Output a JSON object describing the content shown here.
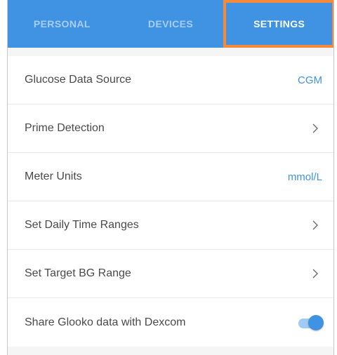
{
  "tabs": [
    {
      "label": "PERSONAL",
      "active": false
    },
    {
      "label": "DEVICES",
      "active": false
    },
    {
      "label": "SETTINGS",
      "active": true
    }
  ],
  "settings": {
    "glucose_source": {
      "label": "Glucose Data Source",
      "value": "CGM"
    },
    "prime_detection": {
      "label": "Prime Detection",
      "icon": "chevron-right-icon"
    },
    "meter_units": {
      "label": "Meter Units",
      "value": "mmol/L"
    },
    "daily_time_ranges": {
      "label": "Set Daily Time Ranges",
      "icon": "chevron-right-icon"
    },
    "target_bg_range": {
      "label": "Set Target BG Range",
      "icon": "chevron-right-icon"
    },
    "share_dexcom": {
      "label": "Share Glooko data with Dexcom",
      "enabled": true
    }
  },
  "colors": {
    "accent": "#3f93e2",
    "highlight_border": "#f58a3a",
    "tab_inactive": "#a9cdf2",
    "label_text": "#4a4a4a"
  }
}
